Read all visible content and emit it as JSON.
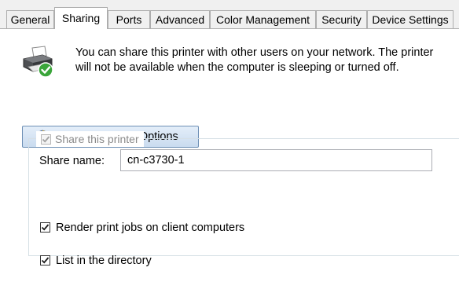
{
  "tabs": [
    {
      "label": "General"
    },
    {
      "label": "Sharing"
    },
    {
      "label": "Ports"
    },
    {
      "label": "Advanced"
    },
    {
      "label": "Color Management"
    },
    {
      "label": "Security"
    },
    {
      "label": "Device Settings"
    }
  ],
  "active_tab": "Sharing",
  "sharing": {
    "description": "You can share this printer with other users on your network. The printer will not be available when the computer is sleeping or turned off.",
    "change_button_label": "Change Sharing Options",
    "share_printer_label": "Share this printer",
    "share_printer_checked": true,
    "share_printer_enabled": false,
    "share_name_label": "Share name:",
    "share_name_value": "cn-c3730-1",
    "render_jobs_label": "Render print jobs on client computers",
    "render_jobs_checked": true,
    "list_directory_label": "List in the directory",
    "list_directory_checked": true
  },
  "icons": {
    "printer": "printer-shared-icon",
    "shield": "uac-shield-icon",
    "check": "checkmark-icon"
  },
  "colors": {
    "button_border": "#6d8fb5",
    "tab_border": "#adadad",
    "disabled_text": "#8a8a8a",
    "check_green": "#3aa53a"
  }
}
